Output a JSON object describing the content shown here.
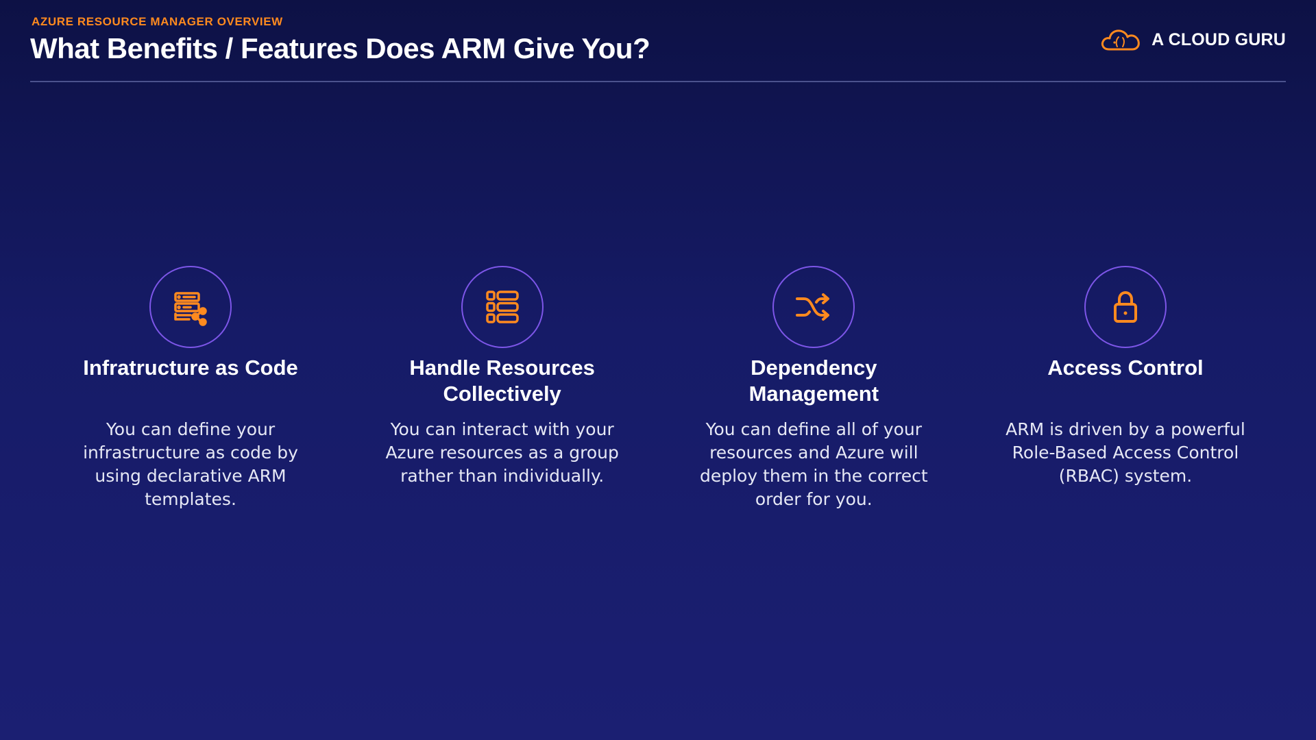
{
  "header": {
    "eyebrow": "AZURE RESOURCE MANAGER OVERVIEW",
    "title": "What Benefits / Features Does ARM Give You?"
  },
  "brand": {
    "name": "A CLOUD GURU",
    "logo_icon": "cloud-logo-icon"
  },
  "colors": {
    "accent": "#ff8a1f",
    "circle_border": "#7d56e8",
    "background": "#161b67"
  },
  "features": [
    {
      "icon": "server-share-icon",
      "title": "Infratructure as Code",
      "description": "You can define your infrastructure as code by using declarative ARM templates."
    },
    {
      "icon": "list-icon",
      "title": "Handle Resources Collectively",
      "description": "You can interact with your Azure resources as a group rather than individually."
    },
    {
      "icon": "shuffle-icon",
      "title": "Dependency Management",
      "description": "You can define all of your resources and Azure will deploy them in the correct order for you."
    },
    {
      "icon": "lock-icon",
      "title": "Access Control",
      "description": "ARM is driven by a powerful Role-Based Access Control (RBAC) system."
    }
  ]
}
